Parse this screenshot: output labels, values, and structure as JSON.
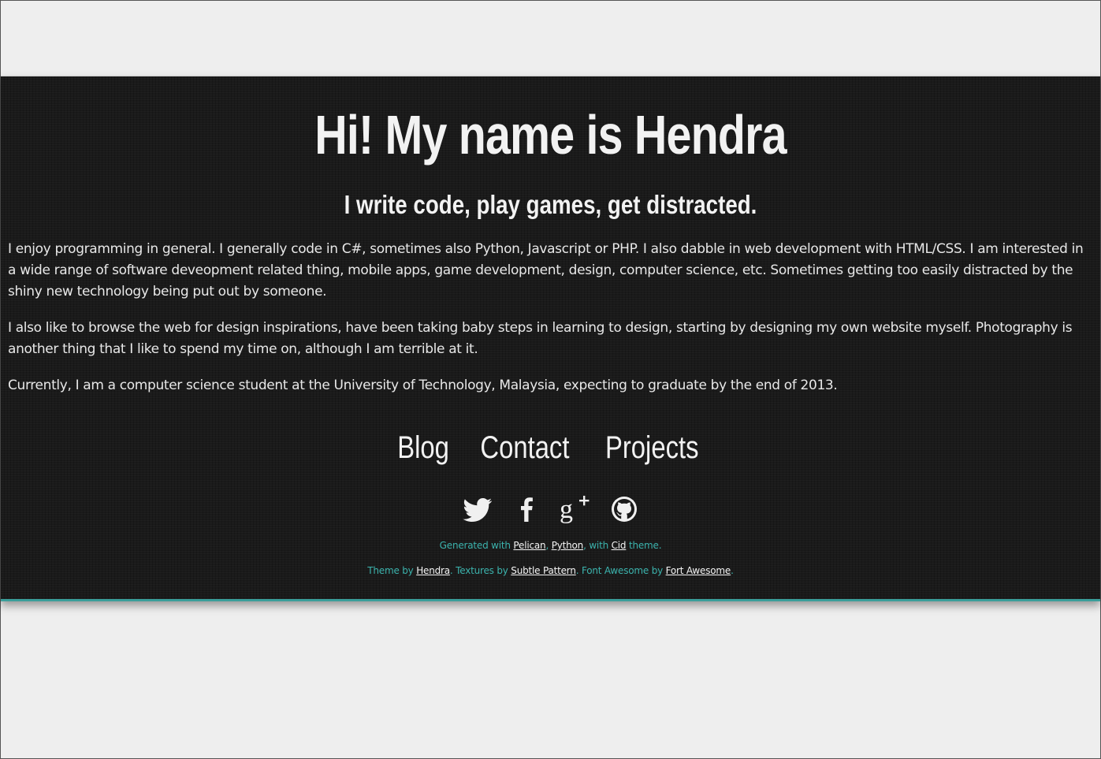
{
  "hero": {
    "title": "Hi! My name is Hendra",
    "tagline": "I write code, play games, get distracted."
  },
  "about": {
    "paragraphs": [
      "I enjoy programming in general. I generally code in C#, sometimes also Python, Javascript or PHP. I also dabble in web development with HTML/CSS. I am interested in a wide range of software deveopment related thing, mobile apps, game development, design, computer science, etc. Sometimes getting too easily distracted by the shiny new technology being put out by someone.",
      "I also like to browse the web for design inspirations, have been taking baby steps in learning to design, starting by designing my own website myself. Photography is another thing that I like to spend my time on, although I am terrible at it.",
      "Currently, I am a computer science student at the University of Technology, Malaysia, expecting to graduate by the end of 2013."
    ]
  },
  "nav": {
    "items": [
      {
        "label": "Blog"
      },
      {
        "label": "Contact"
      },
      {
        "label": "Projects"
      }
    ]
  },
  "social": {
    "icons": [
      "twitter-icon",
      "facebook-icon",
      "google-plus-icon",
      "github-icon"
    ]
  },
  "footer": {
    "line1": {
      "prefix": "Generated with ",
      "link1": "Pelican",
      "sep1": ", ",
      "link2": "Python",
      "sep2": ", with ",
      "link3": "Cid",
      "suffix": " theme."
    },
    "line2": {
      "prefix": "Theme by ",
      "link1": "Hendra",
      "sep1": ". Textures by ",
      "link2": "Subtle Pattern",
      "sep2": ". Font Awesome by ",
      "link3": "Fort Awesome",
      "suffix": "."
    }
  },
  "colors": {
    "page_bg": "#eeeeee",
    "panel_bg": "#1a1a1a",
    "accent": "#3bb3ad",
    "text": "#f0f0f0"
  }
}
